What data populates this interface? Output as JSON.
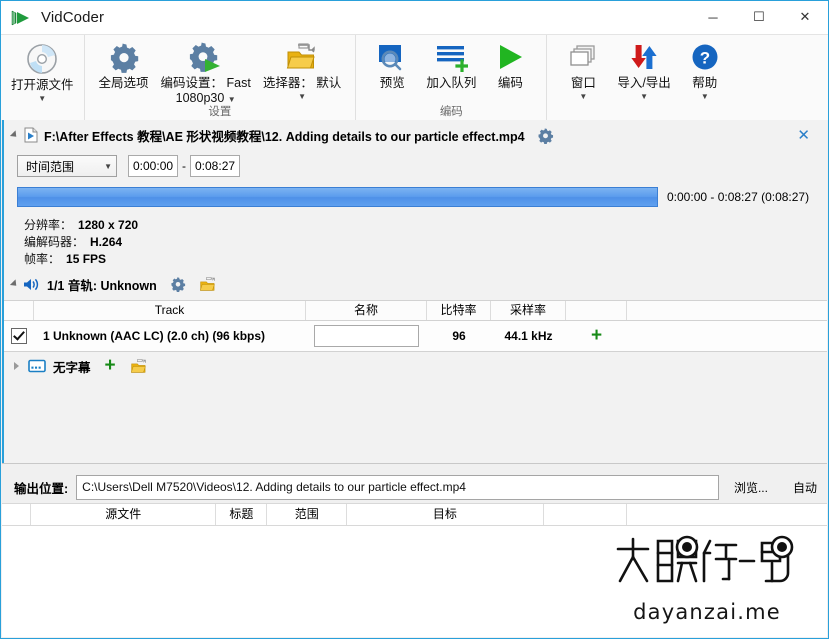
{
  "window": {
    "title": "VidCoder",
    "logo_icon": "play-triangle-logo",
    "minimize_label": "─",
    "maximize_label": "☐",
    "close_label": "✕"
  },
  "ribbon": {
    "groups": [
      {
        "name": "source",
        "title": "",
        "buttons": [
          {
            "id": "open-source",
            "label": "打开源文件",
            "label2": "",
            "icon": "disc-icon",
            "has_caret": true
          }
        ]
      },
      {
        "name": "settings",
        "title": "设置",
        "buttons": [
          {
            "id": "global-options",
            "label": "全局选项",
            "label2": "",
            "icon": "gear-icon",
            "has_caret": false
          },
          {
            "id": "encoding-settings",
            "label": "编码设置： Fast",
            "label2": "1080p30",
            "icon": "gear-play-icon",
            "has_caret": true
          },
          {
            "id": "picker",
            "label": "选择器： 默认",
            "label2": "",
            "icon": "folder-arrow-icon",
            "has_caret": true
          }
        ]
      },
      {
        "name": "encode",
        "title": "编码",
        "buttons": [
          {
            "id": "preview",
            "label": "预览",
            "label2": "",
            "icon": "preview-magnifier-icon",
            "has_caret": false
          },
          {
            "id": "add-to-queue",
            "label": "加入队列",
            "label2": "",
            "icon": "queue-add-icon",
            "has_caret": false
          },
          {
            "id": "encode",
            "label": "编码",
            "label2": "",
            "icon": "play-green-icon",
            "has_caret": false
          }
        ]
      },
      {
        "name": "tools",
        "title": "",
        "buttons": [
          {
            "id": "window",
            "label": "窗口",
            "label2": "",
            "icon": "windows-stack-icon",
            "has_caret": true
          },
          {
            "id": "import-export",
            "label": "导入/导出",
            "label2": "",
            "icon": "import-export-arrows-icon",
            "has_caret": true
          },
          {
            "id": "help",
            "label": "帮助",
            "label2": "",
            "icon": "help-question-icon",
            "has_caret": true
          }
        ]
      }
    ]
  },
  "source": {
    "path": "F:\\After Effects 教程\\AE 形状视频教程\\12. Adding details to our particle effect.mp4",
    "file_icon": "video-file-icon",
    "gear_icon": "gear-icon",
    "close_icon": "close-icon",
    "range": {
      "mode": "时间范围",
      "start": "0:00:00",
      "end": "0:08:27",
      "separator": "-"
    },
    "timeline_label": "0:00:00 - 0:08:27   (0:08:27)",
    "timeline_fill_percent": 100,
    "info": [
      {
        "key": "分辨率：",
        "value": "1280 x 720"
      },
      {
        "key": "编解码器：",
        "value": "H.264"
      },
      {
        "key": "帧率：",
        "value": "15 FPS"
      }
    ]
  },
  "audio": {
    "header_title": "1/1 音轨: Unknown",
    "speaker_icon": "speaker-icon",
    "gear_icon": "gear-icon",
    "copy_icon": "folder-arrow-icon",
    "columns": [
      "",
      "Track",
      "名称",
      "比特率",
      "采样率",
      "",
      ""
    ],
    "rows": [
      {
        "checked": true,
        "track": "1 Unknown (AAC LC) (2.0 ch) (96 kbps)",
        "name_value": "",
        "name_placeholder": "",
        "bitrate": "96",
        "samplerate": "44.1 kHz",
        "add_label": "+"
      }
    ]
  },
  "subtitles": {
    "label": "无字幕",
    "icon": "subtitle-icon",
    "add_label": "+",
    "copy_icon": "folder-arrow-icon"
  },
  "output": {
    "label": "输出位置:",
    "path": "C:\\Users\\Dell M7520\\Videos\\12. Adding details to our particle effect.mp4",
    "browse_label": "浏览...",
    "auto_label": "自动"
  },
  "queue": {
    "columns": [
      "",
      "源文件",
      "标题",
      "范围",
      "目标",
      "",
      ""
    ],
    "rows": []
  },
  "watermark": {
    "text": "dayanzai.me",
    "logo_alt": "大眼仔-旭"
  },
  "colors": {
    "accent": "#29a0da",
    "timeline_blue": "#5b9ced",
    "green": "#178a17",
    "gear_blue": "#5b7fa6",
    "folder_yellow": "#e8b10c"
  }
}
